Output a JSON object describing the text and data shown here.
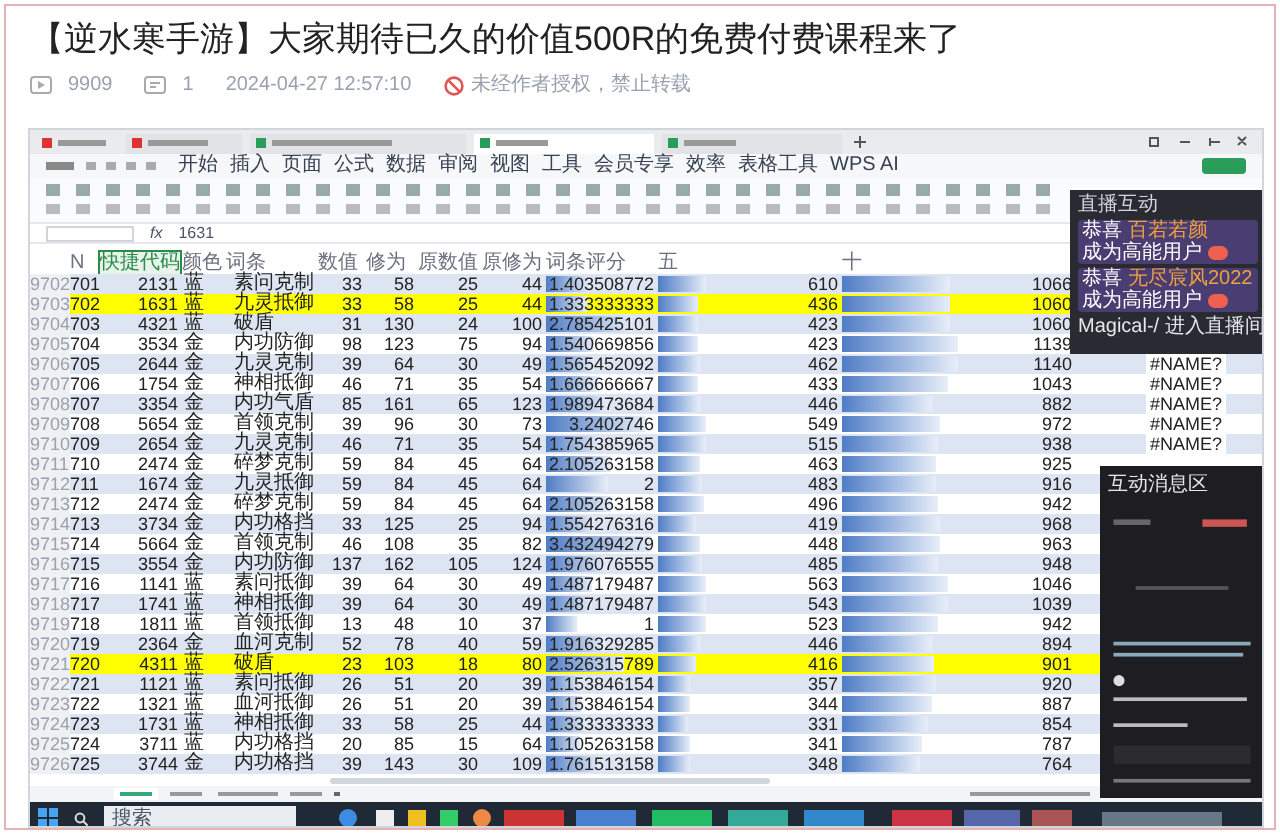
{
  "article": {
    "title": "【逆水寒手游】大家期待已久的价值500R的免费付费课程来了",
    "views": "9909",
    "comments": "1",
    "datetime": "2024-04-27 12:57:10",
    "notice": "未经作者授权，禁止转载"
  },
  "spreadsheet": {
    "menu": [
      "开始",
      "插入",
      "页面",
      "公式",
      "数据",
      "审阅",
      "视图",
      "工具",
      "会员专享",
      "效率",
      "表格工具",
      "WPS AI"
    ],
    "formula_label": "fx",
    "formula": "1631",
    "headings": [
      "N",
      "快捷代码",
      "颜色",
      "词条",
      "数值",
      "修为",
      "原数值",
      "原修为",
      "词条评分",
      "五",
      "十"
    ],
    "rows": [
      {
        "row_number": "9702",
        "cells": [
          "701",
          "2131",
          "蓝",
          "素问克制",
          "33",
          "58",
          "25",
          "44",
          "1.403508772",
          "610",
          "1066"
        ],
        "highlighted": false
      },
      {
        "row_number": "9703",
        "cells": [
          "702",
          "1631",
          "蓝",
          "九灵抵御",
          "33",
          "58",
          "25",
          "44",
          "1.333333333",
          "436",
          "1060"
        ],
        "highlighted": true
      },
      {
        "row_number": "9704",
        "cells": [
          "703",
          "4321",
          "蓝",
          "破盾",
          "31",
          "130",
          "24",
          "100",
          "2.785425101",
          "423",
          "1060"
        ],
        "highlighted": false
      },
      {
        "row_number": "9705",
        "cells": [
          "704",
          "3534",
          "金",
          "内功防御",
          "98",
          "123",
          "75",
          "94",
          "1.540669856",
          "423",
          "1139"
        ],
        "highlighted": false
      },
      {
        "row_number": "9706",
        "cells": [
          "705",
          "2644",
          "金",
          "九灵克制",
          "39",
          "64",
          "30",
          "49",
          "1.565452092",
          "462",
          "1140"
        ],
        "highlighted": false,
        "error": "#NAME?"
      },
      {
        "row_number": "9707",
        "cells": [
          "706",
          "1754",
          "金",
          "神相抵御",
          "46",
          "71",
          "35",
          "54",
          "1.666666667",
          "433",
          "1043"
        ],
        "highlighted": false,
        "error": "#NAME?"
      },
      {
        "row_number": "9708",
        "cells": [
          "707",
          "3354",
          "金",
          "内功气盾",
          "85",
          "161",
          "65",
          "123",
          "1.989473684",
          "446",
          "882"
        ],
        "highlighted": false,
        "error": "#NAME?"
      },
      {
        "row_number": "9709",
        "cells": [
          "708",
          "5654",
          "金",
          "首领克制",
          "39",
          "96",
          "30",
          "73",
          "3.2402746",
          "549",
          "972"
        ],
        "highlighted": false,
        "error": "#NAME?"
      },
      {
        "row_number": "9710",
        "cells": [
          "709",
          "2654",
          "金",
          "九灵克制",
          "46",
          "71",
          "35",
          "54",
          "1.754385965",
          "515",
          "938"
        ],
        "highlighted": false,
        "error": "#NAME?"
      },
      {
        "row_number": "9711",
        "cells": [
          "710",
          "2474",
          "金",
          "碎梦克制",
          "59",
          "84",
          "45",
          "64",
          "2.105263158",
          "463",
          "925"
        ],
        "highlighted": false
      },
      {
        "row_number": "9712",
        "cells": [
          "711",
          "1674",
          "金",
          "九灵抵御",
          "59",
          "84",
          "45",
          "64",
          "2",
          "483",
          "916"
        ],
        "highlighted": false
      },
      {
        "row_number": "9713",
        "cells": [
          "712",
          "2474",
          "金",
          "碎梦克制",
          "59",
          "84",
          "45",
          "64",
          "2.105263158",
          "496",
          "942"
        ],
        "highlighted": false
      },
      {
        "row_number": "9714",
        "cells": [
          "713",
          "3734",
          "金",
          "内功格挡",
          "33",
          "125",
          "25",
          "94",
          "1.554276316",
          "419",
          "968"
        ],
        "highlighted": false
      },
      {
        "row_number": "9715",
        "cells": [
          "714",
          "5664",
          "金",
          "首领克制",
          "46",
          "108",
          "35",
          "82",
          "3.432494279",
          "448",
          "963"
        ],
        "highlighted": false
      },
      {
        "row_number": "9716",
        "cells": [
          "715",
          "3554",
          "金",
          "内功防御",
          "137",
          "162",
          "105",
          "124",
          "1.976076555",
          "485",
          "948"
        ],
        "highlighted": false
      },
      {
        "row_number": "9717",
        "cells": [
          "716",
          "1141",
          "蓝",
          "素问抵御",
          "39",
          "64",
          "30",
          "49",
          "1.487179487",
          "563",
          "1046"
        ],
        "highlighted": false
      },
      {
        "row_number": "9718",
        "cells": [
          "717",
          "1741",
          "蓝",
          "神相抵御",
          "39",
          "64",
          "30",
          "49",
          "1.487179487",
          "543",
          "1039"
        ],
        "highlighted": false
      },
      {
        "row_number": "9719",
        "cells": [
          "718",
          "1811",
          "蓝",
          "首领抵御",
          "13",
          "48",
          "10",
          "37",
          "1",
          "523",
          "942"
        ],
        "highlighted": false
      },
      {
        "row_number": "9720",
        "cells": [
          "719",
          "2364",
          "金",
          "血河克制",
          "52",
          "78",
          "40",
          "59",
          "1.916329285",
          "446",
          "894"
        ],
        "highlighted": false
      },
      {
        "row_number": "9721",
        "cells": [
          "720",
          "4311",
          "蓝",
          "破盾",
          "23",
          "103",
          "18",
          "80",
          "2.526315789",
          "416",
          "901"
        ],
        "highlighted": true
      },
      {
        "row_number": "9722",
        "cells": [
          "721",
          "1121",
          "蓝",
          "素问抵御",
          "26",
          "51",
          "20",
          "39",
          "1.153846154",
          "357",
          "920"
        ],
        "highlighted": false
      },
      {
        "row_number": "9723",
        "cells": [
          "722",
          "1321",
          "蓝",
          "血河抵御",
          "26",
          "51",
          "20",
          "39",
          "1.153846154",
          "344",
          "887"
        ],
        "highlighted": false
      },
      {
        "row_number": "9724",
        "cells": [
          "723",
          "1731",
          "蓝",
          "神相抵御",
          "33",
          "58",
          "25",
          "44",
          "1.333333333",
          "331",
          "854"
        ],
        "highlighted": false
      },
      {
        "row_number": "9725",
        "cells": [
          "724",
          "3711",
          "蓝",
          "内功格挡",
          "20",
          "85",
          "15",
          "64",
          "1.105263158",
          "341",
          "787"
        ],
        "highlighted": false
      },
      {
        "row_number": "9726",
        "cells": [
          "725",
          "3744",
          "金",
          "内功格挡",
          "39",
          "143",
          "30",
          "109",
          "1.761513158",
          "348",
          "764"
        ],
        "highlighted": false
      }
    ],
    "taskbar": {
      "search_placeholder": "搜索"
    }
  },
  "live_panel": {
    "title": "直播互动",
    "notices": [
      {
        "prefix": "恭喜",
        "user": "百若若颜",
        "suffix": "成为高能用户"
      },
      {
        "prefix": "恭喜",
        "user": "无尽宸风2022",
        "suffix": "成为高能用户"
      }
    ],
    "entry": "Magical-/ 进入直播间"
  },
  "chat_panel": {
    "title": "互动消息区"
  }
}
